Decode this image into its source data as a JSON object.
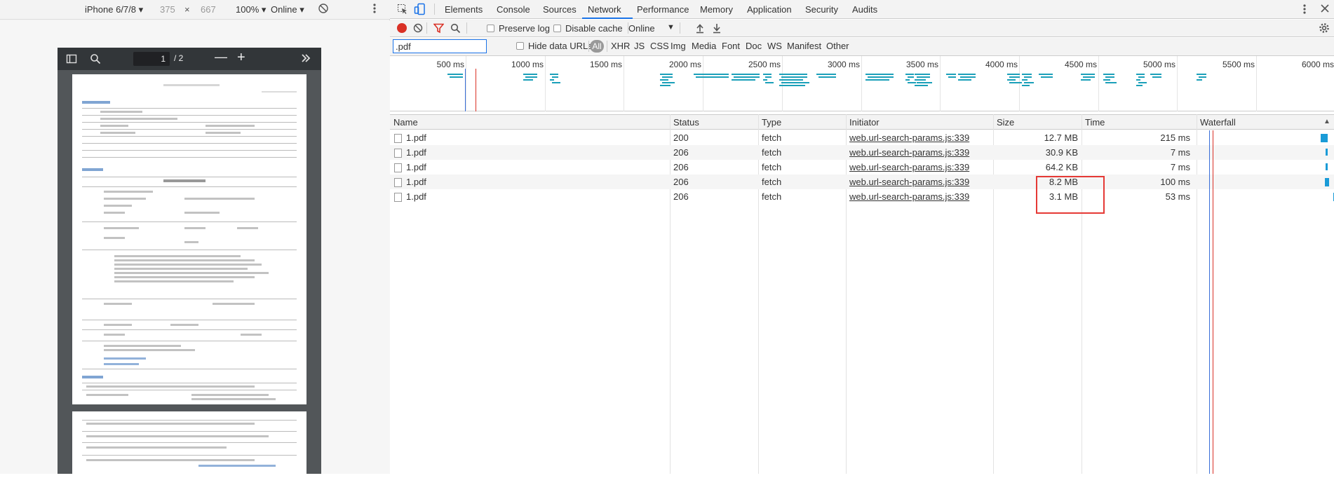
{
  "device_toolbar": {
    "device": "iPhone 6/7/8",
    "width": "375",
    "times": "×",
    "height": "667",
    "zoom": "100%",
    "network": "Online"
  },
  "pdf_viewer": {
    "page_current": "1",
    "page_total": "/ 2",
    "minus": "—",
    "plus": "+"
  },
  "devtools": {
    "tabs": [
      "Elements",
      "Console",
      "Sources",
      "Network",
      "Performance",
      "Memory",
      "Application",
      "Security",
      "Audits"
    ],
    "active_tab": "Network",
    "toolbar": {
      "preserve_log": "Preserve log",
      "disable_cache": "Disable cache",
      "throttle": "Online"
    },
    "filter": {
      "value": ".pdf",
      "hide_data_urls": "Hide data URLs",
      "types": [
        "All",
        "XHR",
        "JS",
        "CSS",
        "Img",
        "Media",
        "Font",
        "Doc",
        "WS",
        "Manifest",
        "Other"
      ]
    },
    "overview_ticks": [
      "500 ms",
      "1000 ms",
      "1500 ms",
      "2000 ms",
      "2500 ms",
      "3000 ms",
      "3500 ms",
      "4000 ms",
      "4500 ms",
      "5000 ms",
      "5500 ms",
      "6000 ms"
    ],
    "columns": [
      "Name",
      "Status",
      "Type",
      "Initiator",
      "Size",
      "Time",
      "Waterfall"
    ],
    "rows": [
      {
        "name": "1.pdf",
        "status": "200",
        "type": "fetch",
        "initiator": "web.url-search-params.js:339",
        "size": "12.7 MB",
        "time": "215 ms"
      },
      {
        "name": "1.pdf",
        "status": "206",
        "type": "fetch",
        "initiator": "web.url-search-params.js:339",
        "size": "30.9 KB",
        "time": "7 ms"
      },
      {
        "name": "1.pdf",
        "status": "206",
        "type": "fetch",
        "initiator": "web.url-search-params.js:339",
        "size": "64.2 KB",
        "time": "7 ms"
      },
      {
        "name": "1.pdf",
        "status": "206",
        "type": "fetch",
        "initiator": "web.url-search-params.js:339",
        "size": "8.2 MB",
        "time": "100 ms"
      },
      {
        "name": "1.pdf",
        "status": "206",
        "type": "fetch",
        "initiator": "web.url-search-params.js:339",
        "size": "3.1 MB",
        "time": "53 ms"
      }
    ]
  },
  "colors": {
    "accent": "#1a73e8",
    "record": "#d93025",
    "highlight_box": "#e53935",
    "waterfall_bar": "#1a9bd7",
    "overview_bar": "#1ba0b9"
  }
}
